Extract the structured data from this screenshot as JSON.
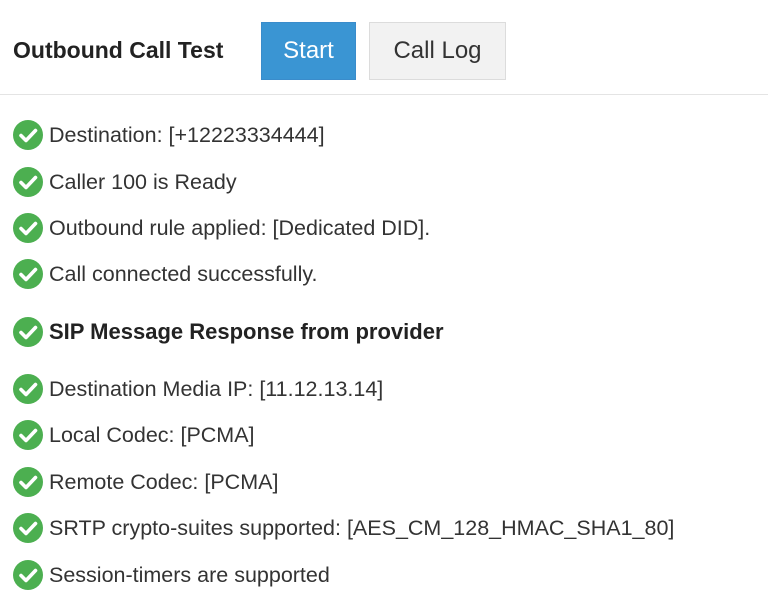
{
  "header": {
    "title": "Outbound Call Test",
    "start_label": "Start",
    "call_log_label": "Call Log"
  },
  "colors": {
    "primary_button": "#3a95d3",
    "secondary_button": "#f2f2f2",
    "success_icon": "#4caf50"
  },
  "icons": {
    "status": "check-circle-icon"
  },
  "results": [
    {
      "text": "Destination: [+12223334444]",
      "bold": false
    },
    {
      "text": "Caller 100 is Ready",
      "bold": false
    },
    {
      "text": "Outbound rule applied: [Dedicated DID].",
      "bold": false
    },
    {
      "text": "Call connected successfully.",
      "bold": false
    },
    {
      "text": "SIP Message Response from provider",
      "bold": true
    },
    {
      "text": "Destination Media IP: [11.12.13.14]",
      "bold": false
    },
    {
      "text": "Local Codec: [PCMA]",
      "bold": false
    },
    {
      "text": "Remote Codec: [PCMA]",
      "bold": false
    },
    {
      "text": "SRTP crypto-suites supported: [AES_CM_128_HMAC_SHA1_80]",
      "bold": false
    },
    {
      "text": "Session-timers are supported",
      "bold": false
    }
  ]
}
